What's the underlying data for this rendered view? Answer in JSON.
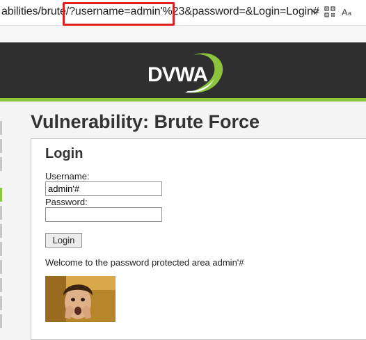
{
  "browser": {
    "url_prefix": "abilities/brute/",
    "url_query": "?username=admin'%23",
    "url_suffix": "&password=&Login=Login#",
    "icons": [
      "chevron-down-icon",
      "qr-code-icon",
      "reader-mode-icon"
    ]
  },
  "header": {
    "logo_text": "DVWA",
    "accent_color": "#8cc43e"
  },
  "page": {
    "title": "Vulnerability: Brute Force"
  },
  "login": {
    "heading": "Login",
    "username_label": "Username:",
    "username_value": "admin'#",
    "password_label": "Password:",
    "password_value": "",
    "button_label": "Login",
    "welcome_text": "Welcome to the password protected area admin'#"
  }
}
